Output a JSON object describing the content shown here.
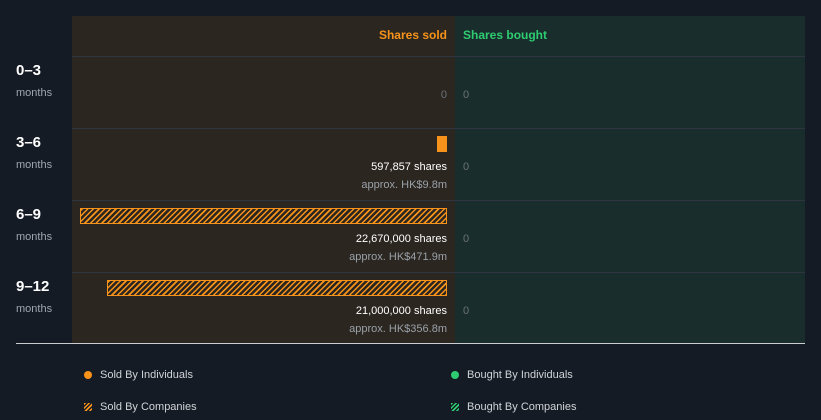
{
  "chart_data": {
    "type": "bar",
    "header": {
      "sold": "Shares sold",
      "bought": "Shares bought"
    },
    "colors": {
      "sold": "#f7931a",
      "bought": "#2ecc71"
    },
    "max_shares": 22670000,
    "rows": [
      {
        "period": "0–3",
        "unit": "months",
        "sold_individuals": 0,
        "sold_companies": 0,
        "sold_label": "0",
        "sold_approx": "",
        "bought_label": "0"
      },
      {
        "period": "3–6",
        "unit": "months",
        "sold_individuals": 597857,
        "sold_companies": 0,
        "sold_label": "597,857 shares",
        "sold_approx": "approx. HK$9.8m",
        "bought_label": "0"
      },
      {
        "period": "6–9",
        "unit": "months",
        "sold_individuals": 0,
        "sold_companies": 22670000,
        "sold_label": "22,670,000 shares",
        "sold_approx": "approx. HK$471.9m",
        "bought_label": "0"
      },
      {
        "period": "9–12",
        "unit": "months",
        "sold_individuals": 0,
        "sold_companies": 21000000,
        "sold_label": "21,000,000 shares",
        "sold_approx": "approx. HK$356.8m",
        "bought_label": "0"
      }
    ],
    "legend": [
      {
        "label": "Sold By Individuals",
        "icon": "orange-dot-icon"
      },
      {
        "label": "Bought By Individuals",
        "icon": "green-dot-icon"
      },
      {
        "label": "Sold By Companies",
        "icon": "orange-hatch-icon"
      },
      {
        "label": "Bought By Companies",
        "icon": "green-hatch-icon"
      }
    ]
  }
}
